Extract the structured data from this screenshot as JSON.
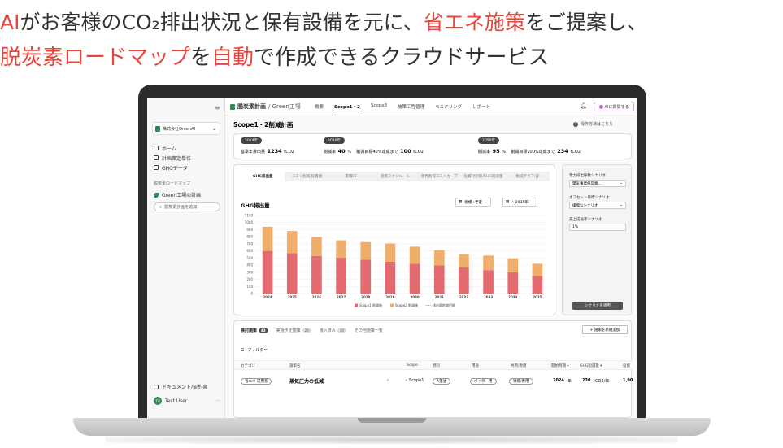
{
  "headline": {
    "line1": [
      {
        "text": "AI",
        "red": true
      },
      {
        "text": "がお客様の",
        "red": false
      },
      {
        "text": "CO₂",
        "red": false
      },
      {
        "text": "排出状況と保有設備を元に、",
        "red": false
      },
      {
        "text": "省エネ施策",
        "red": true
      },
      {
        "text": "をご提案し、",
        "red": false
      }
    ],
    "line2": [
      {
        "text": "脱炭素ロードマップ",
        "red": true
      },
      {
        "text": "を",
        "red": false
      },
      {
        "text": "自動",
        "red": true
      },
      {
        "text": "で作成できるクラウドサービス",
        "red": false
      }
    ]
  },
  "sidebar": {
    "org": "株式会社GreenAI",
    "nav": [
      "ホーム",
      "計画策定単位",
      "GHGデータ"
    ],
    "section_label": "脱炭素ロードマップ",
    "plan_item": "Green工場の計画",
    "add_plan": "脱炭素計画を追加",
    "docs": "ドキュメント/契約書",
    "user_initials": "TU",
    "user_name": "Test User",
    "more": "···"
  },
  "topbar": {
    "title": "脱炭素計画",
    "subtitle": "/ Green工場",
    "tabs": [
      {
        "label": "概要",
        "active": false
      },
      {
        "label": "Scope1・2",
        "active": true
      },
      {
        "label": "Scope3",
        "active": false
      },
      {
        "label": "施策工程管理",
        "active": false
      },
      {
        "label": "モニタリング",
        "active": false
      },
      {
        "label": "レポート",
        "active": false
      }
    ],
    "ai_button": "AIに質問する"
  },
  "main": {
    "title": "Scope1・2削減計画",
    "help": "操作方法はこちら",
    "targets": [
      {
        "year": "2024年",
        "label": "基準年排出量",
        "value": "1234",
        "unit": "tCO2",
        "label2": "",
        "value2": "",
        "unit2": ""
      },
      {
        "year": "2030年",
        "label": "削減率",
        "value": "40",
        "unit": "%",
        "label2": "削減目標40%達成まで",
        "value2": "100",
        "unit2": "tCO2"
      },
      {
        "year": "2050年",
        "label": "削減率",
        "value": "95",
        "unit": "%",
        "label2": "削減目標100%達成まで",
        "value2": "234",
        "unit2": "tCO2"
      }
    ],
    "chart_tabs": [
      {
        "label": "GHG排出量",
        "active": true
      },
      {
        "label": "コスト削減/投資額",
        "active": false
      },
      {
        "label": "累積CF",
        "active": false
      },
      {
        "label": "施策スケジュール",
        "active": false
      },
      {
        "label": "限界削減コストカーブ",
        "active": false
      },
      {
        "label": "投資対効果/GHG削減量",
        "active": false
      },
      {
        "label": "削減グラフ/詳",
        "active": false
      }
    ],
    "chart_title": "GHG排出量",
    "select1": "指標+予定",
    "select2": "〜2035年",
    "side": {
      "label1": "電力排出係数シナリオ",
      "value1": "電気事業低炭素...",
      "label2": "オフセット目標シナリオ",
      "value2": "緩慢なシナリオ",
      "label3": "売上成長率シナリオ",
      "value3": "1%",
      "button": "シナリオを適用"
    },
    "list": {
      "tabs": [
        {
          "label": "検討施策",
          "count": "43",
          "active": true
        },
        {
          "label": "実施予定施策",
          "count": "20",
          "active": false
        },
        {
          "label": "導入済み",
          "count": "30",
          "active": false
        },
        {
          "label": "その他施策一覧",
          "count": "",
          "active": false
        }
      ],
      "new_button": "+ 施策を新規追加",
      "filter": "フィルター",
      "headers": [
        "カテゴリ",
        "施策名",
        "Scope",
        "燃料",
        "用途",
        "共用/専用",
        "開始時期 ▾",
        "GHG削減量 ▾",
        "投資"
      ],
      "row": {
        "category": "省エネ 運用系",
        "name": "蒸気圧力の低減",
        "scope": "Scope1",
        "fuel": "A重油",
        "use": "ボイラー用",
        "shared": "現場/専用",
        "start": "2024",
        "start_unit": "年",
        "ghg": "230",
        "ghg_unit": "tCO2/年",
        "invest": "1,00"
      }
    }
  },
  "colors": {
    "accent_red": "#e8453c",
    "scope1": "#e36a6f",
    "scope2": "#f0ae6b",
    "brand_green": "#2e8b57"
  },
  "chart_data": {
    "type": "bar",
    "stacked": true,
    "categories": [
      "2024",
      "2025",
      "2026",
      "2027",
      "2028",
      "2029",
      "2030",
      "2031",
      "2032",
      "2033",
      "2034",
      "2035"
    ],
    "series": [
      {
        "name": "Scope1 削減後",
        "values": [
          600,
          570,
          530,
          505,
          475,
          450,
          420,
          395,
          370,
          330,
          300,
          250
        ]
      },
      {
        "name": "Scope2 削減後",
        "values": [
          340,
          310,
          265,
          245,
          250,
          255,
          240,
          215,
          185,
          205,
          195,
          170
        ]
      }
    ],
    "line_legend": "排出量削減目標",
    "ylim": [
      0,
      1100
    ],
    "yticks": [
      0,
      100,
      200,
      300,
      400,
      500,
      600,
      700,
      800,
      900,
      1000,
      1100
    ]
  }
}
